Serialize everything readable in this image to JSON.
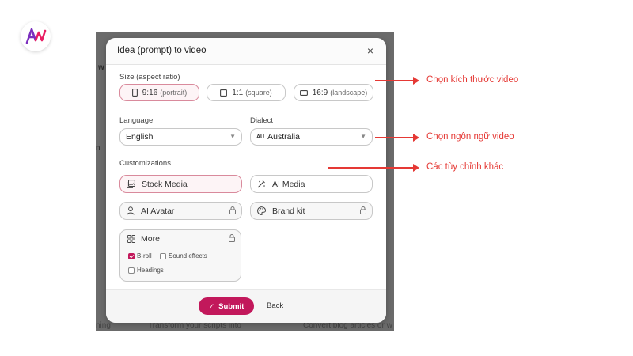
{
  "logo": {
    "icon": "av-logo-icon",
    "colors": [
      "#7b2fbe",
      "#e91e63"
    ]
  },
  "background": {
    "snippets": [
      "w",
      "n",
      "ning",
      "Transform your scripts into",
      "Convert blog articles or w"
    ]
  },
  "modal": {
    "title": "Idea (prompt) to video",
    "close_label": "×",
    "size": {
      "label": "Size (aspect ratio)",
      "options": [
        {
          "main": "9:16",
          "sub": "(portrait)",
          "selected": true
        },
        {
          "main": "1:1",
          "sub": "(square)",
          "selected": false
        },
        {
          "main": "16:9",
          "sub": "(landscape)",
          "selected": false
        }
      ]
    },
    "language": {
      "label": "Language",
      "value": "English"
    },
    "dialect": {
      "label": "Dialect",
      "code": "AU",
      "value": "Australia"
    },
    "customizations": {
      "label": "Customizations",
      "options": [
        {
          "label": "Stock Media",
          "selected": true,
          "locked": false,
          "icon": "stock-media-icon"
        },
        {
          "label": "AI Media",
          "selected": false,
          "locked": false,
          "icon": "ai-media-icon"
        },
        {
          "label": "AI Avatar",
          "selected": false,
          "locked": true,
          "icon": "avatar-icon"
        },
        {
          "label": "Brand kit",
          "selected": false,
          "locked": true,
          "icon": "palette-icon"
        }
      ],
      "more": {
        "label": "More",
        "checkboxes": [
          {
            "label": "B-roll",
            "checked": true
          },
          {
            "label": "Sound effects",
            "checked": false
          },
          {
            "label": "Headings",
            "checked": false
          }
        ]
      }
    },
    "footer": {
      "submit_label": "Submit",
      "back_label": "Back"
    }
  },
  "annotations": [
    "Chọn kích thước video",
    "Chọn ngôn ngữ video",
    "Các tùy chỉnh khác"
  ],
  "colors": {
    "accent": "#c2185b",
    "annotation": "#e53935"
  }
}
